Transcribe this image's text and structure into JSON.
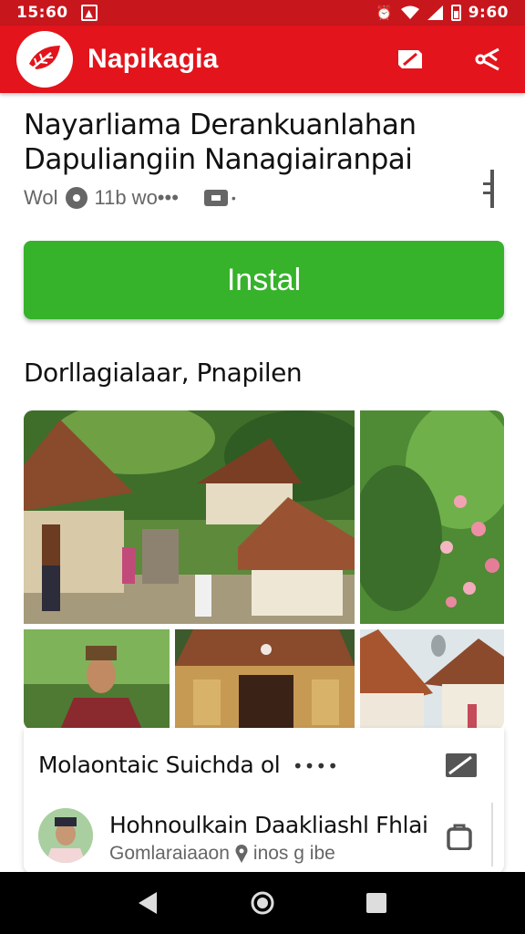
{
  "status_bar": {
    "time_left": "15:60",
    "time_right": "9:60",
    "icons": [
      "notification-icon",
      "alarm-icon",
      "wifi-icon",
      "signal-icon",
      "battery-icon"
    ]
  },
  "app_bar": {
    "title": "Napikagia",
    "colors": {
      "bar": "#e3141c",
      "status": "#c8161d"
    },
    "actions": [
      "edit-icon",
      "share-icon"
    ]
  },
  "article": {
    "headline_line1": "Nayarliama Derankuanlahan",
    "headline_line2": "Dapuliangiin Nanagiairanpai",
    "meta_source": "Wol",
    "meta_count": "11b wo•••",
    "meta_extra": "•"
  },
  "install": {
    "label": "Instal",
    "color": "#36b22b"
  },
  "gallery": {
    "title": "Dorllagialaar, Pnapilen"
  },
  "card": {
    "title": "Molaontaic Suichda",
    "title_suffix": "ol",
    "dots": "••••",
    "author_name": "Hohnoulkain Daakliashl Fhlai",
    "author_sub": "Gomlaraiaaon",
    "author_location": "inos g ibe"
  },
  "nav_bar": {
    "buttons": [
      "back-icon",
      "home-icon",
      "recents-icon"
    ]
  }
}
